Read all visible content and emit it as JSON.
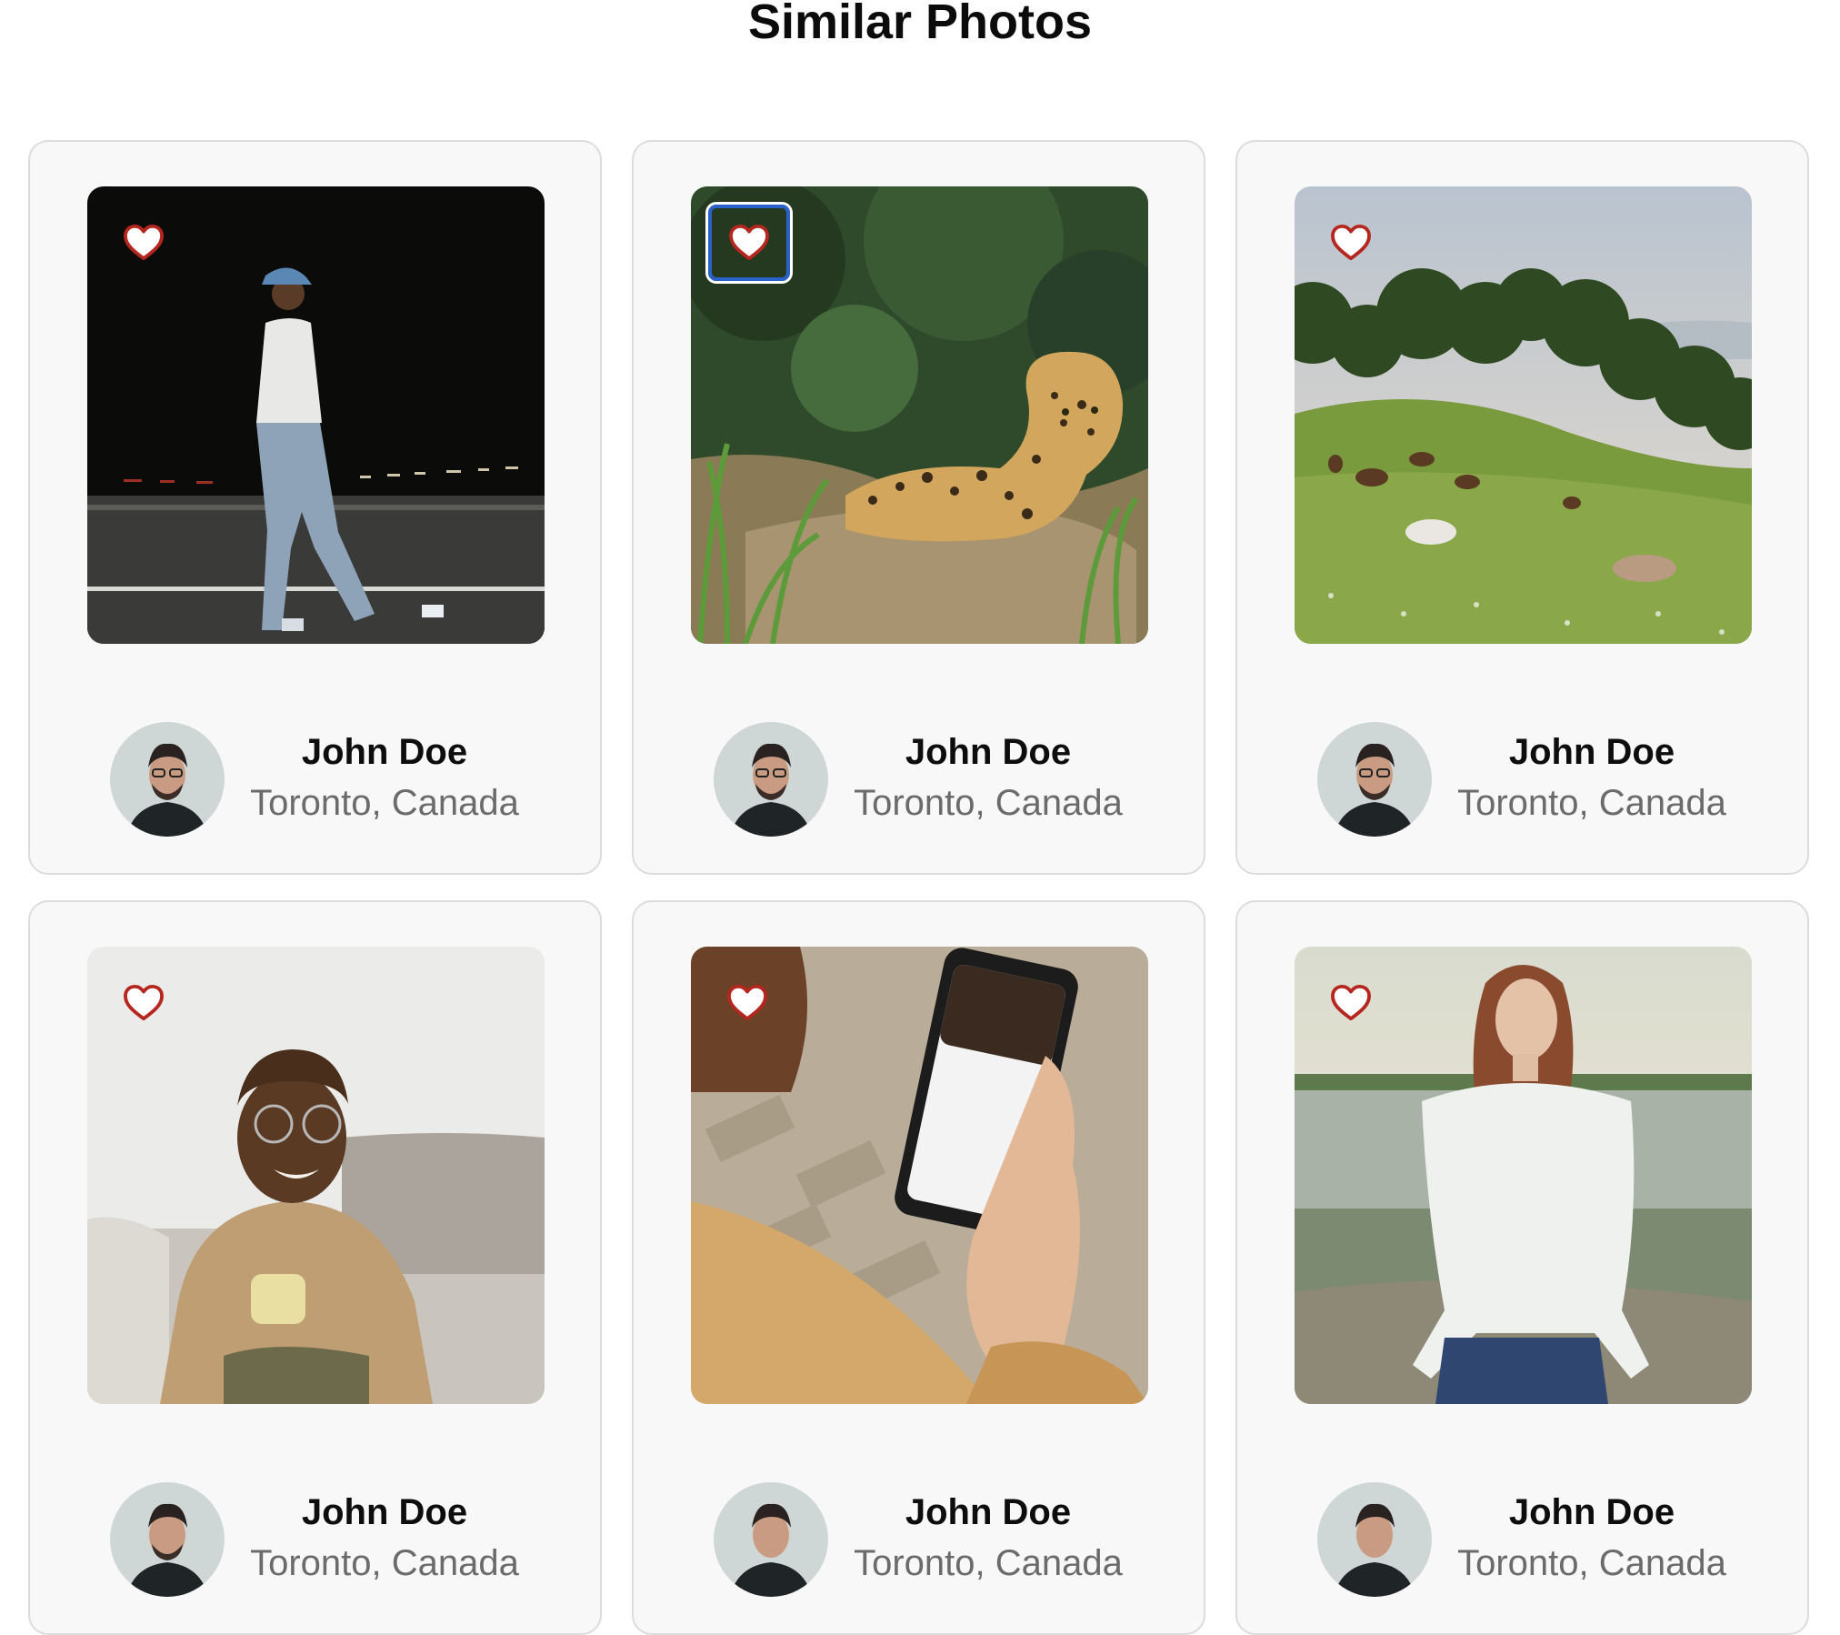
{
  "page": {
    "title": "Similar Photos"
  },
  "colors": {
    "heart": "#b5261e",
    "focus_ring": "#2b62c9",
    "card_bg": "#f8f8f8",
    "card_border": "#dcdcdc"
  },
  "cards": [
    {
      "photo": "man-walking-at-night-photo",
      "like_icon": "heart-outline-icon",
      "liked_focused": false,
      "author": {
        "name": "John Doe",
        "location": "Toronto, Canada"
      }
    },
    {
      "photo": "jaguar-resting-in-grass-photo",
      "like_icon": "heart-outline-icon",
      "liked_focused": true,
      "author": {
        "name": "John Doe",
        "location": "Toronto, Canada"
      }
    },
    {
      "photo": "horses-grazing-on-hillside-photo",
      "like_icon": "heart-outline-icon",
      "liked_focused": false,
      "author": {
        "name": "John Doe",
        "location": "Toronto, Canada"
      }
    },
    {
      "photo": "man-smiling-with-mug-photo",
      "like_icon": "heart-outline-icon",
      "liked_focused": false,
      "author": {
        "name": "John Doe",
        "location": "Toronto, Canada"
      }
    },
    {
      "photo": "hand-holding-smartphone-photo",
      "like_icon": "heart-outline-icon",
      "liked_focused": false,
      "author": {
        "name": "John Doe",
        "location": "Toronto, Canada"
      }
    },
    {
      "photo": "woman-by-lake-photo",
      "like_icon": "heart-outline-icon",
      "liked_focused": false,
      "author": {
        "name": "John Doe",
        "location": "Toronto, Canada"
      }
    }
  ]
}
